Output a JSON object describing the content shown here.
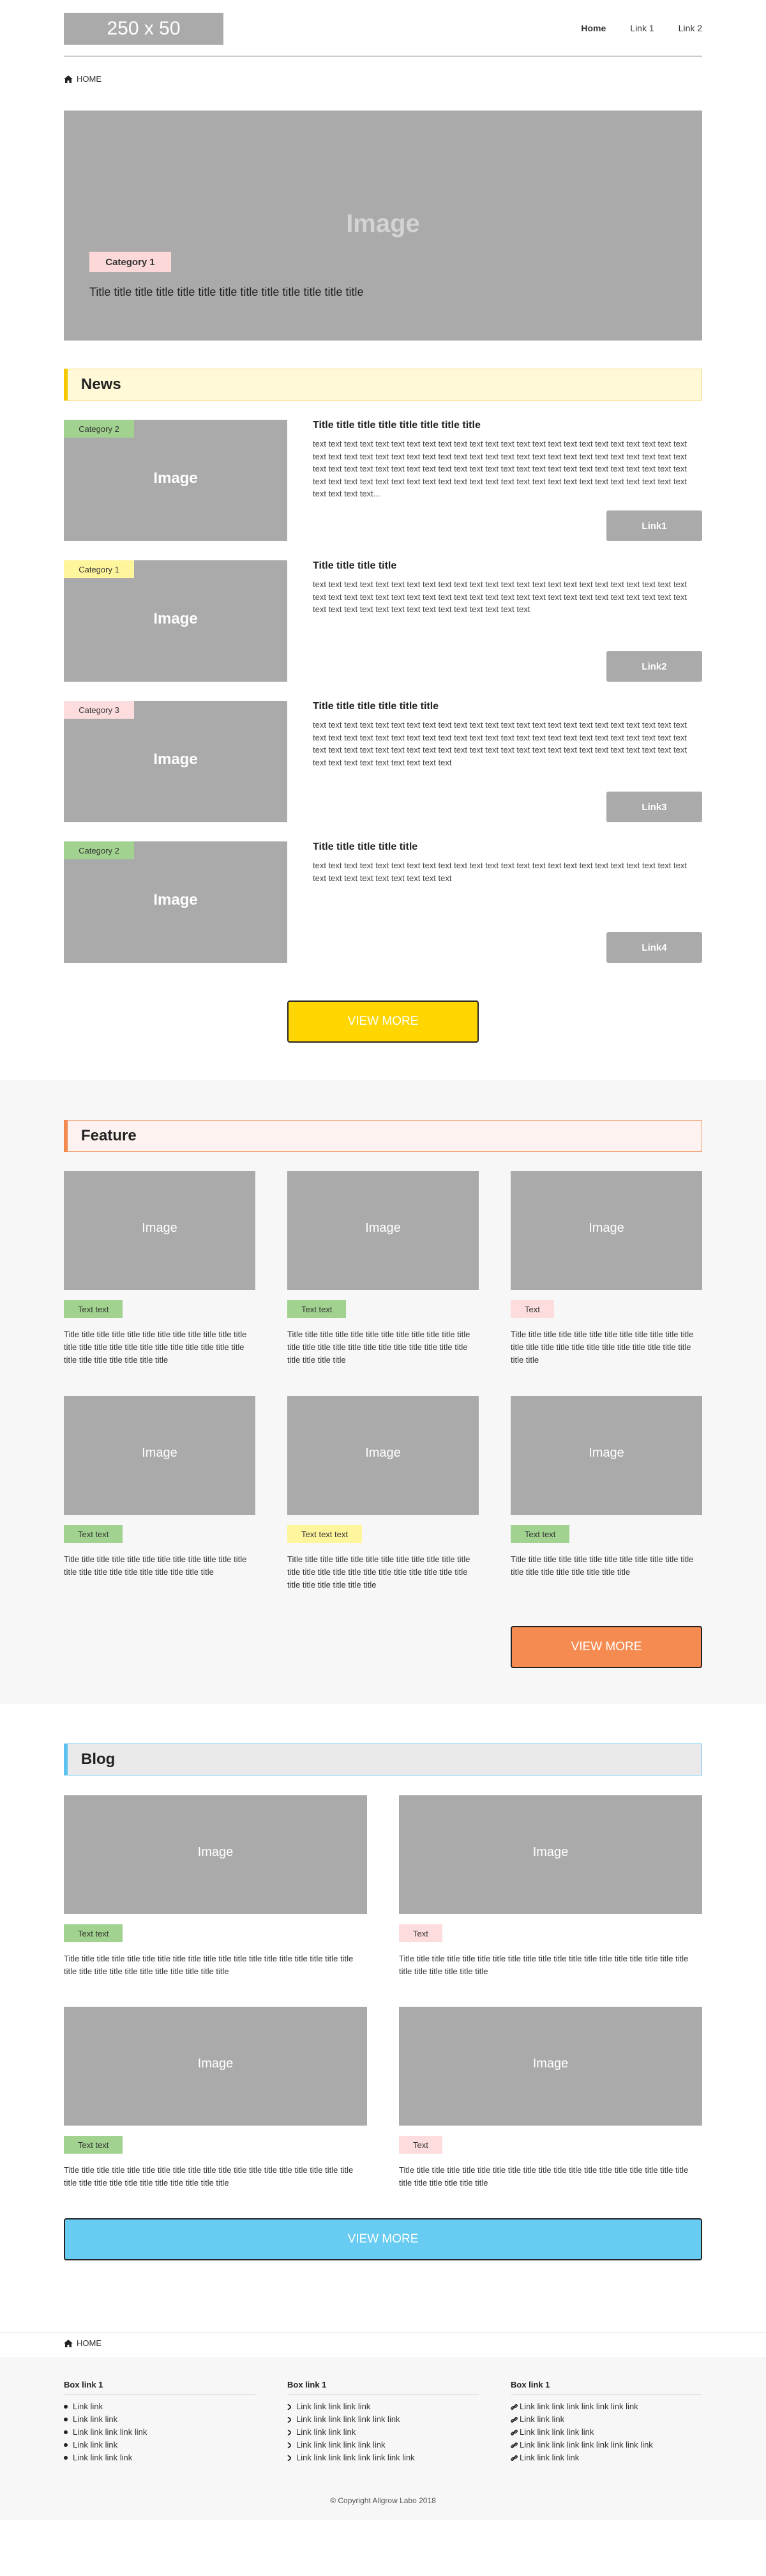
{
  "header": {
    "logo": "250 x 50",
    "nav": [
      "Home",
      "Link 1",
      "Link 2"
    ]
  },
  "breadcrumb": {
    "home": "HOME"
  },
  "hero": {
    "image_label": "Image",
    "category": "Category 1",
    "title": "Title title title  title  title  title  title title  title  title  title  title  title"
  },
  "news": {
    "heading": "News",
    "items": [
      {
        "category": "Category 2",
        "image_label": "Image",
        "title": "Title title title title title title title title",
        "text": "text text text text text text text text text text text text text text text text text text text text text text text text text text text text text text text text text text text text text text text text text text text text text text text text text text text text text text text text text text text text text text text text text text text text text text text text text text text text text text text text text text text text text text text text text text text text text text text text text text text text...",
        "link": "Link1"
      },
      {
        "category": "Category 1",
        "image_label": "Image",
        "title": "Title title title title",
        "text": "text text text text text text text text text text text text text text text text text text text text text text text text text text text text text text text text text text text text text text text text text text text text text text text text text text text text text text text text text text text text text text",
        "link": "Link2"
      },
      {
        "category": "Category 3",
        "image_label": "Image",
        "title": "Title title title title title title",
        "text": "text text text text text text text text text text text text text text text text text text text text text text text text text text text text text text text text text text text text text text text text text text text text text text text text text text text text text text text text text text text text text text text text text text text text text text text text text text text text text text text text text",
        "link": "Link3"
      },
      {
        "category": "Category 2",
        "image_label": "Image",
        "title": "Title title title title title",
        "text": "text text text text text text text text text text text text text text text text text text text text text text text text text text text text text text text text text",
        "link": "Link4"
      }
    ],
    "more": "VIEW MORE"
  },
  "feature": {
    "heading": "Feature",
    "cards": [
      {
        "image_label": "Image",
        "badge": "Text text",
        "badge_color": "#a1d28f",
        "desc": "Title title title title title title title title title title title title title title title title title title title title title title title title title title title title title title title"
      },
      {
        "image_label": "Image",
        "badge": "Text text",
        "badge_color": "#a1d28f",
        "desc": "Title title title title title title title title title title title title title title title title title title title title title title title title title title title title"
      },
      {
        "image_label": "Image",
        "badge": "Text",
        "badge_color": "#fcdcdc",
        "desc": "Title title title title title title title title title title title title title title title title title title title title title title title title title title"
      },
      {
        "image_label": "Image",
        "badge": "Text text",
        "badge_color": "#a1d28f",
        "desc": "Title title title title title title title title title title title title title title title title title title title title title title"
      },
      {
        "image_label": "Image",
        "badge": "Text text text",
        "badge_color": "#fff59d",
        "desc": "Title title title title title title title title title title title title title title title title title title title title title title title title title title title title title title"
      },
      {
        "image_label": "Image",
        "badge": "Text text",
        "badge_color": "#a1d28f",
        "desc": "Title title title title title title title title title title title title title title title title title title title title"
      }
    ],
    "more": "VIEW MORE"
  },
  "blog": {
    "heading": "Blog",
    "cards": [
      {
        "image_label": "Image",
        "badge": "Text text",
        "badge_color": "#a1d28f",
        "desc": "Title title title title title title title title title title title title title title title title title title title title title title title title title title title title title title"
      },
      {
        "image_label": "Image",
        "badge": "Text",
        "badge_color": "#fcdcdc",
        "desc": "Title title title title title title title title title title title title title title title title title title title title title title title title title"
      },
      {
        "image_label": "Image",
        "badge": "Text text",
        "badge_color": "#a1d28f",
        "desc": "Title title title title title title title title title title title title title title title title title title title title title title title title title title title title title title"
      },
      {
        "image_label": "Image",
        "badge": "Text",
        "badge_color": "#fcdcdc",
        "desc": "Title title title title title title title title title title title title title title title title title title title title title title title title title"
      }
    ],
    "more": "VIEW MORE"
  },
  "footer": {
    "breadcrumb": "HOME",
    "columns": [
      {
        "heading": "Box link 1",
        "icon": "bullet-dot-icon",
        "links": [
          "Link link",
          "Link  link link",
          "Link  link link link link",
          "Link link link",
          "Link link link link"
        ]
      },
      {
        "heading": "Box link 1",
        "icon": "chevron-right-icon",
        "links": [
          "Link link link link link",
          "Link  link link link link link link",
          "Link  link link link",
          "Link link link link link link",
          "Link link link link link link link link"
        ]
      },
      {
        "heading": "Box link 1",
        "icon": "chain-link-icon",
        "links": [
          "Link link link link link link link link",
          "Link  link link",
          "Link  link link link link",
          "Link link link link link link link link link",
          "Link link link link"
        ]
      }
    ],
    "copyright": "© Copyright Allgrow Labo 2018"
  },
  "colors": {
    "news_accent": "#f5c800",
    "feature_accent": "#f28a50",
    "blog_accent": "#5cc2f0",
    "news_more": "#ffd600",
    "feature_more": "#f58b50",
    "blog_more": "#67cbf2",
    "placeholder": "#aaaaaa"
  }
}
